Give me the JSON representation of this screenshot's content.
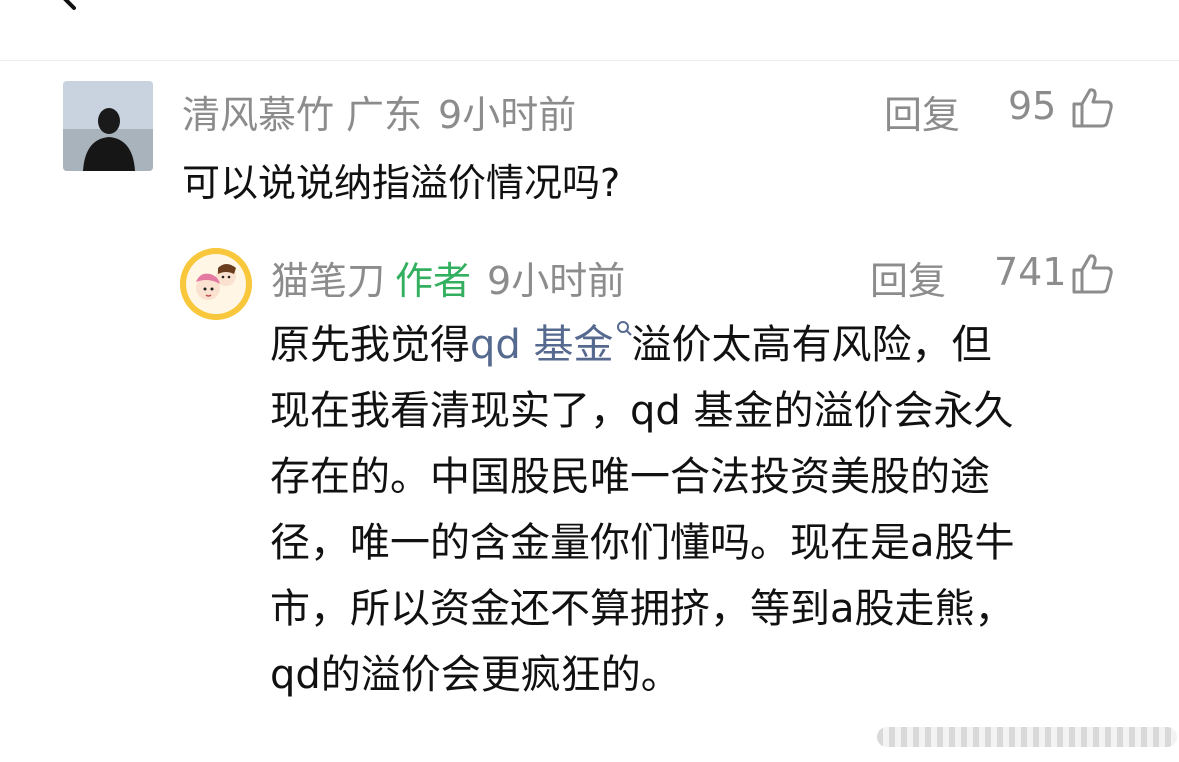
{
  "header": {
    "back_icon": "back-chevron-icon"
  },
  "comment": {
    "author": "清风慕竹",
    "location": "广东",
    "time": "9小时前",
    "reply_label": "回复",
    "likes": "95",
    "text": "可以说说纳指溢价情况吗?",
    "avatar_icon": "avatar-photo",
    "like_icon": "thumbs-up-icon"
  },
  "reply": {
    "author": "猫笔刀",
    "author_tag": "作者",
    "time": "9小时前",
    "reply_label": "回复",
    "likes": "741",
    "avatar_icon": "avatar-cartoon",
    "like_icon": "thumbs-up-icon",
    "text_prefix": "原先我觉得",
    "link_text": "qd 基金",
    "link_icon": "search-icon",
    "line1_suffix": "溢价太高有风险，但",
    "line2": "现在我看清现实了，qd 基金的溢价会永久",
    "line3": "存在的。中国股民唯一合法投资美股的途",
    "line4": "径，唯一的含金量你们懂吗。现在是a股牛",
    "line5": "市，所以资金还不算拥挤，等到a股走熊，",
    "line6": "qd的溢价会更疯狂的。"
  },
  "colors": {
    "meta_gray": "#8c8c8c",
    "author_tag_green": "#33b05f",
    "link_blue": "#56698f",
    "text": "#111111"
  }
}
